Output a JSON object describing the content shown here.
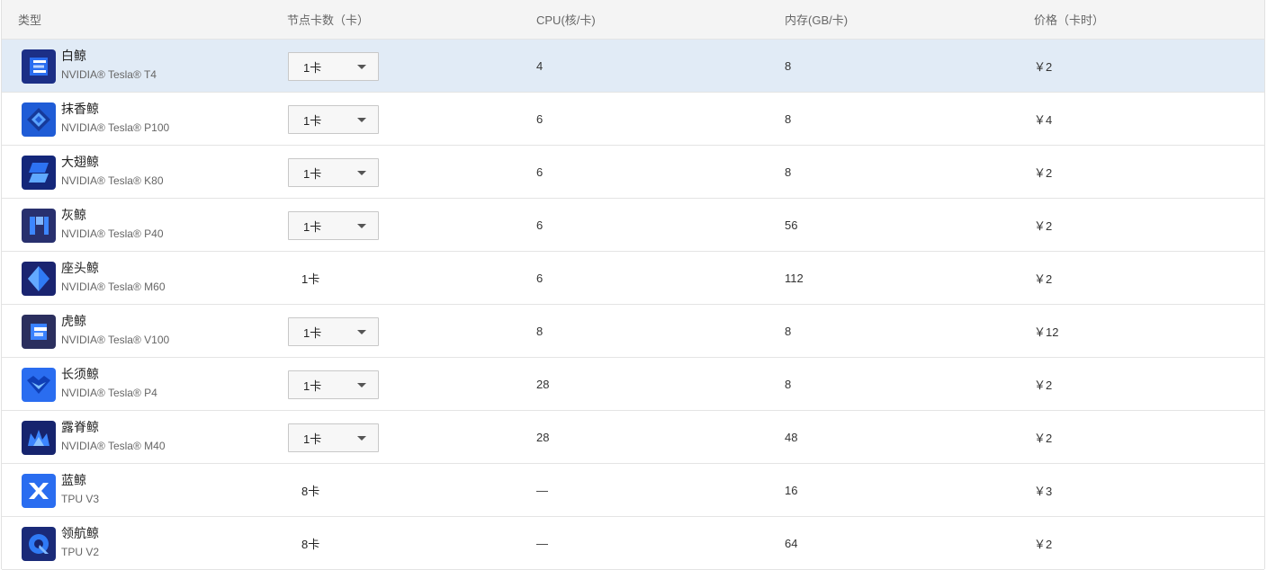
{
  "header": {
    "type": "类型",
    "cards": "节点卡数（卡）",
    "cpu": "CPU(核/卡)",
    "memory": "内存(GB/卡)",
    "price": "价格（卡时）"
  },
  "rows": [
    {
      "name": "白鲸",
      "model": "NVIDIA® Tesla® T4",
      "cards": "1卡",
      "has_dropdown": true,
      "cpu": "4",
      "memory": "8",
      "price": "￥2",
      "icon": "baijing-icon",
      "selected": true
    },
    {
      "name": "抹香鲸",
      "model": "NVIDIA® Tesla® P100",
      "cards": "1卡",
      "has_dropdown": true,
      "cpu": "6",
      "memory": "8",
      "price": "￥4",
      "icon": "moxiangjing-icon"
    },
    {
      "name": "大翅鲸",
      "model": "NVIDIA® Tesla® K80",
      "cards": "1卡",
      "has_dropdown": true,
      "cpu": "6",
      "memory": "8",
      "price": "￥2",
      "icon": "dachijing-icon"
    },
    {
      "name": "灰鲸",
      "model": "NVIDIA® Tesla® P40",
      "cards": "1卡",
      "has_dropdown": true,
      "cpu": "6",
      "memory": "56",
      "price": "￥2",
      "icon": "huijing-icon"
    },
    {
      "name": "座头鲸",
      "model": "NVIDIA® Tesla® M60",
      "cards": "1卡",
      "has_dropdown": false,
      "cpu": "6",
      "memory": "112",
      "price": "￥2",
      "icon": "zuotoujing-icon"
    },
    {
      "name": "虎鲸",
      "model": "NVIDIA® Tesla® V100",
      "cards": "1卡",
      "has_dropdown": true,
      "cpu": "8",
      "memory": "8",
      "price": "￥12",
      "icon": "hujing-icon"
    },
    {
      "name": "长须鲸",
      "model": "NVIDIA® Tesla® P4",
      "cards": "1卡",
      "has_dropdown": true,
      "cpu": "28",
      "memory": "8",
      "price": "￥2",
      "icon": "changxujing-icon"
    },
    {
      "name": "露脊鲸",
      "model": "NVIDIA® Tesla® M40",
      "cards": "1卡",
      "has_dropdown": true,
      "cpu": "28",
      "memory": "48",
      "price": "￥2",
      "icon": "lujijing-icon"
    },
    {
      "name": "蓝鲸",
      "model": "TPU V3",
      "cards": "8卡",
      "has_dropdown": false,
      "cpu": "—",
      "memory": "16",
      "price": "￥3",
      "icon": "lanjing-icon"
    },
    {
      "name": "领航鲸",
      "model": "TPU V2",
      "cards": "8卡",
      "has_dropdown": false,
      "cpu": "—",
      "memory": "64",
      "price": "￥2",
      "icon": "linghangjing-icon"
    }
  ],
  "colors": {
    "selected_row": "#e1ebf6",
    "header_bg": "#f4f4f4",
    "icon_blue": "#1f5cd6",
    "icon_navy": "#1c2f86"
  }
}
